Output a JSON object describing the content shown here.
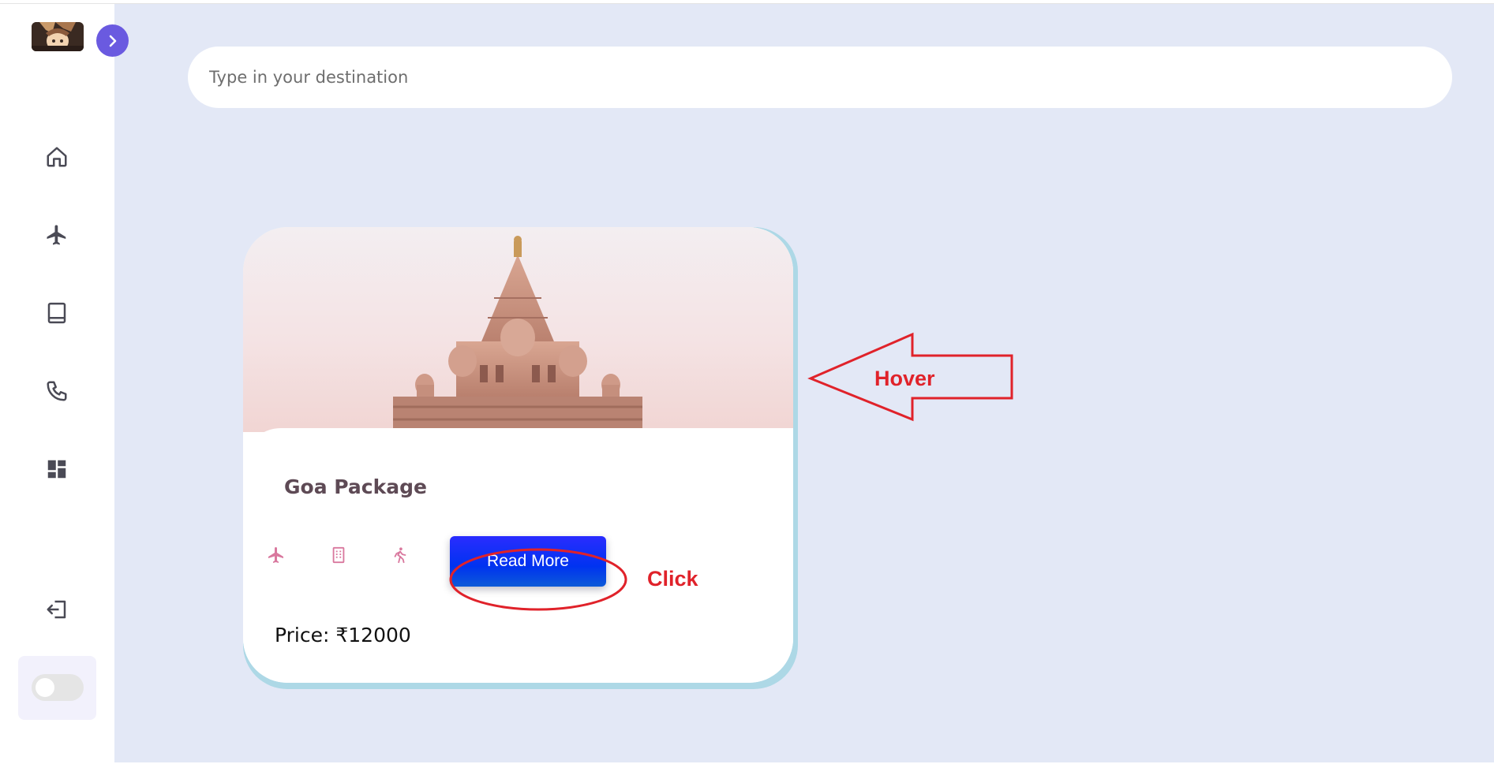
{
  "search": {
    "placeholder": "Type in your destination"
  },
  "sidebar": {
    "items": [
      {
        "name": "home",
        "icon": "home-icon"
      },
      {
        "name": "flights",
        "icon": "airplane-icon"
      },
      {
        "name": "bookings",
        "icon": "book-icon"
      },
      {
        "name": "contact",
        "icon": "phone-icon"
      },
      {
        "name": "dashboard",
        "icon": "dashboard-icon"
      }
    ],
    "logout_icon": "logout-icon",
    "theme_toggle": "off"
  },
  "card": {
    "title": "Goa Package",
    "features": [
      "airplane-icon",
      "hotel-building-icon",
      "activity-walking-icon"
    ],
    "button_label": "Read More",
    "price": "Price: ₹12000"
  },
  "annotations": {
    "hover": "Hover",
    "click": "Click"
  },
  "colors": {
    "accent": "#6a5ae0",
    "main_bg": "#e3e8f6",
    "card_shadow": "#add8e6",
    "annotation": "#e0222a",
    "feature_icon": "#d9789e"
  }
}
